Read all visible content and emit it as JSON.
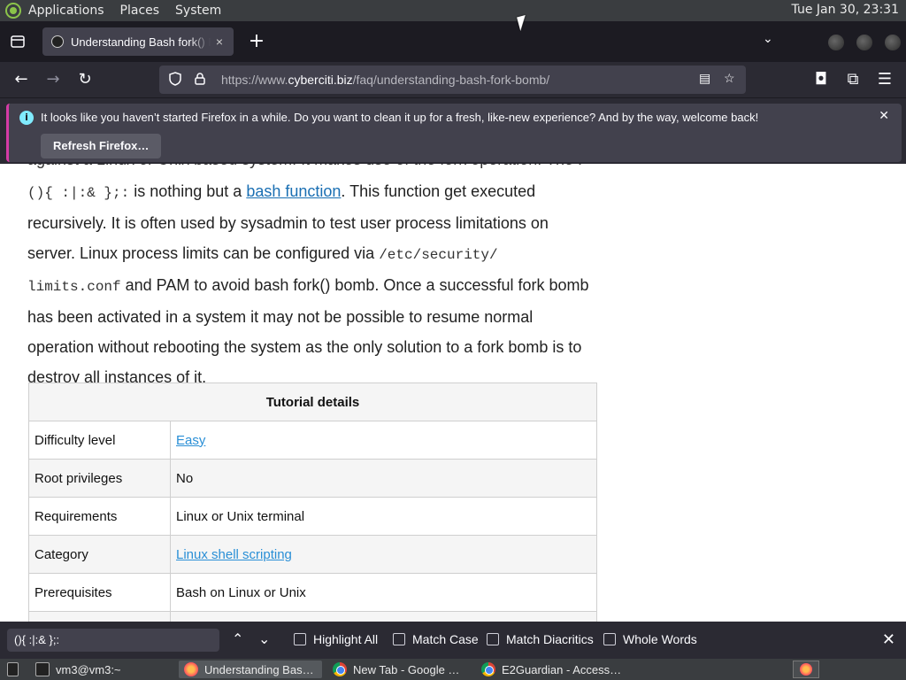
{
  "topbar": {
    "menus": [
      "Applications",
      "Places",
      "System"
    ],
    "clock": "Tue Jan 30, 23:31"
  },
  "tabs": {
    "active_title": "Understanding Bash fork() B",
    "close_icon": "×",
    "newtab_icon": "+"
  },
  "navbar": {
    "url_prefix": "https://www.",
    "url_domain": "cyberciti.biz",
    "url_path": "/faq/understanding-bash-fork-bomb/"
  },
  "notification": {
    "message": "It looks like you haven’t started Firefox in a while. Do you want to clean it up for a fresh, like-new experience? And by the way, welcome back!",
    "button": "Refresh Firefox…"
  },
  "article": {
    "cut_line": "against a Linux or Unix based system. It makes use of the fork operation. The :",
    "code1": "(){ :|:& };:",
    "text1": " is nothing but a ",
    "link1": "bash function",
    "text2": ". This function get executed recursively. It is often used by sysadmin to test user process limitations on server. Linux process limits can be configured via ",
    "code2": "/etc/security/ limits.conf",
    "text3": " and PAM to avoid bash fork() bomb. Once a successful fork bomb has been activated in a system it may not be possible to resume normal operation without rebooting the system as the only solution to a fork bomb is to destroy all instances of it."
  },
  "table": {
    "header": "Tutorial details",
    "rows": [
      {
        "key": "Difficulty level",
        "value": "Easy",
        "link": true
      },
      {
        "key": "Root privileges",
        "value": "No",
        "link": false
      },
      {
        "key": "Requirements",
        "value": "Linux or Unix terminal",
        "link": false
      },
      {
        "key": "Category",
        "value": "Linux shell scripting",
        "link": true
      },
      {
        "key": "Prerequisites",
        "value": "Bash on Linux or Unix",
        "link": false
      }
    ]
  },
  "findbar": {
    "query": "(){ :|:& };:",
    "highlight_all": "Highlight All",
    "match_case": "Match Case",
    "match_diacritics": "Match Diacritics",
    "whole_words": "Whole Words"
  },
  "taskbar": {
    "items": [
      "vm3@vm3:~",
      "Understanding Bas…",
      "New Tab - Google …",
      "E2Guardian - Access…"
    ]
  }
}
